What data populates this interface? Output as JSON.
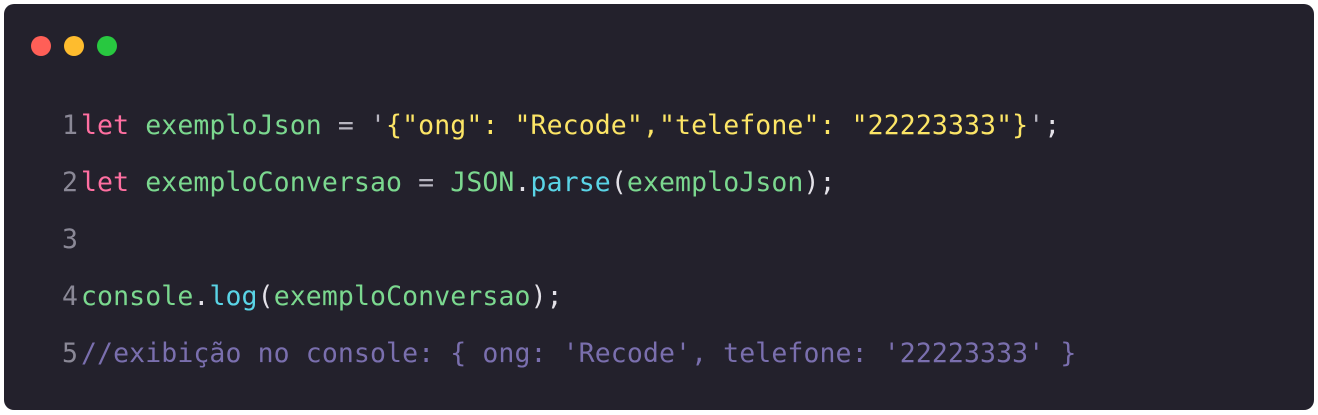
{
  "window": {
    "traffic_lights": [
      {
        "name": "close",
        "color": "#ff5f57"
      },
      {
        "name": "minimize",
        "color": "#febc2e"
      },
      {
        "name": "maximize",
        "color": "#28c840"
      }
    ],
    "background": "#23212c"
  },
  "colors": {
    "keyword": "#ff6fa1",
    "variable": "#7bd88f",
    "operator": "#b7b5c0",
    "string": "#fce566",
    "method": "#5ad4e6",
    "plain": "#e3e1e8",
    "comment": "#7a6fae",
    "line_number": "#8a8896"
  },
  "code": {
    "lines": [
      {
        "number": "1",
        "tokens": [
          {
            "text": "let ",
            "kind": "keyword"
          },
          {
            "text": "exemploJson ",
            "kind": "variable"
          },
          {
            "text": "= ",
            "kind": "operator"
          },
          {
            "text": "'",
            "kind": "operator"
          },
          {
            "text": "{\"ong\": \"Recode\",\"telefone\": \"22223333\"}",
            "kind": "string"
          },
          {
            "text": "'",
            "kind": "operator"
          },
          {
            "text": ";",
            "kind": "plain"
          }
        ]
      },
      {
        "number": "2",
        "tokens": [
          {
            "text": "let ",
            "kind": "keyword"
          },
          {
            "text": "exemploConversao ",
            "kind": "variable"
          },
          {
            "text": "= ",
            "kind": "operator"
          },
          {
            "text": "JSON",
            "kind": "variable"
          },
          {
            "text": ".",
            "kind": "plain"
          },
          {
            "text": "parse",
            "kind": "method"
          },
          {
            "text": "(",
            "kind": "plain"
          },
          {
            "text": "exemploJson",
            "kind": "variable"
          },
          {
            "text": ");",
            "kind": "plain"
          }
        ]
      },
      {
        "number": "3",
        "tokens": []
      },
      {
        "number": "4",
        "tokens": [
          {
            "text": "console",
            "kind": "variable"
          },
          {
            "text": ".",
            "kind": "plain"
          },
          {
            "text": "log",
            "kind": "method"
          },
          {
            "text": "(",
            "kind": "plain"
          },
          {
            "text": "exemploConversao",
            "kind": "variable"
          },
          {
            "text": ");",
            "kind": "plain"
          }
        ]
      },
      {
        "number": "5",
        "tokens": [
          {
            "text": "//exibição no console: { ong: 'Recode', telefone: '22223333' }",
            "kind": "comment"
          }
        ]
      }
    ]
  }
}
